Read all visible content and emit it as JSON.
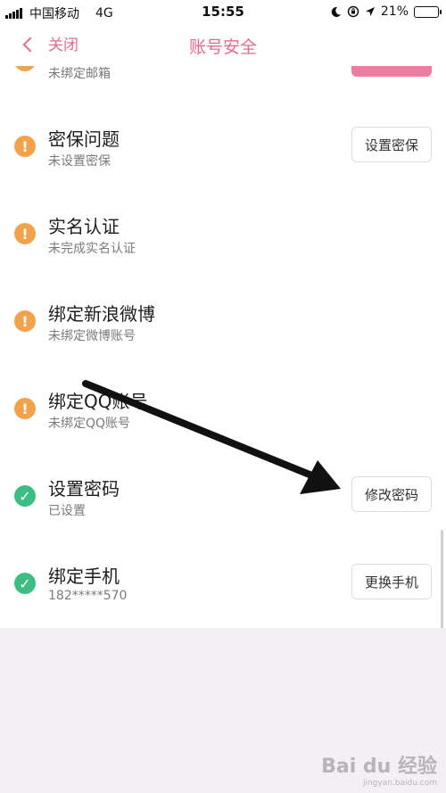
{
  "status_bar": {
    "carrier": "中国移动",
    "network": "4G",
    "time": "15:55",
    "battery": "21%",
    "battery_level": 0.21
  },
  "nav": {
    "back_label": "关闭",
    "title": "账号安全"
  },
  "partial_row": {
    "subtitle": "未绑定邮箱"
  },
  "rows": [
    {
      "title": "密保问题",
      "subtitle": "未设置密保",
      "status": "warning",
      "action": "设置密保"
    },
    {
      "title": "实名认证",
      "subtitle": "未完成实名认证",
      "status": "warning",
      "action": ""
    },
    {
      "title": "绑定新浪微博",
      "subtitle": "未绑定微博账号",
      "status": "warning",
      "action": ""
    },
    {
      "title": "绑定QQ账号",
      "subtitle": "未绑定QQ账号",
      "status": "warning",
      "action": ""
    },
    {
      "title": "设置密码",
      "subtitle": "已设置",
      "status": "ok",
      "action": "修改密码"
    },
    {
      "title": "绑定手机",
      "subtitle": "182*****570",
      "status": "ok",
      "action": "更换手机"
    }
  ],
  "icons": {
    "warning": "!",
    "ok": "✓"
  },
  "colors": {
    "accent": "#e46a8b",
    "warning": "#f2a24a",
    "ok": "#3dbd84"
  },
  "watermark": {
    "text": "Bai du 经验",
    "sub": "jingyan.baidu.com"
  }
}
